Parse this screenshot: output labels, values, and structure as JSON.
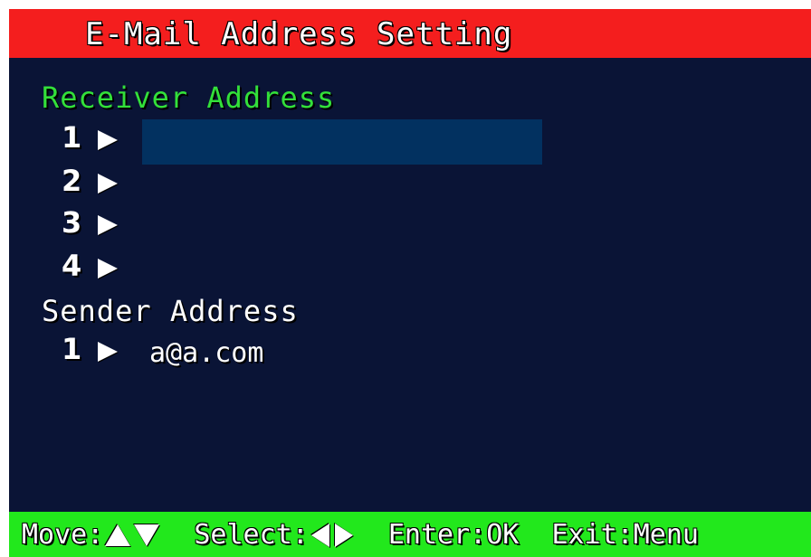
{
  "title": "E-Mail Address Setting",
  "receiver": {
    "label": "Receiver Address",
    "rows": [
      {
        "index": "1",
        "value": ""
      },
      {
        "index": "2",
        "value": ""
      },
      {
        "index": "3",
        "value": ""
      },
      {
        "index": "4",
        "value": ""
      }
    ]
  },
  "sender": {
    "label": "Sender Address",
    "rows": [
      {
        "index": "1",
        "value": "a@a.com"
      }
    ]
  },
  "footer": {
    "move_label": "Move:",
    "select_label": "Select:",
    "enter_label": "Enter:OK",
    "exit_label": "Exit:Menu"
  },
  "icons": {
    "row_arrow": "triangle-right-icon",
    "move_up": "triangle-up-icon",
    "move_down": "triangle-down-icon",
    "select_left": "triangle-left-icon",
    "select_right": "triangle-right-icon"
  },
  "colors": {
    "title_bar": "#f41e1e",
    "background": "#0a1436",
    "receiver_label": "#33e03a",
    "selected_field": "#023160",
    "footer_bar": "#22e81c",
    "text": "#ffffff"
  }
}
